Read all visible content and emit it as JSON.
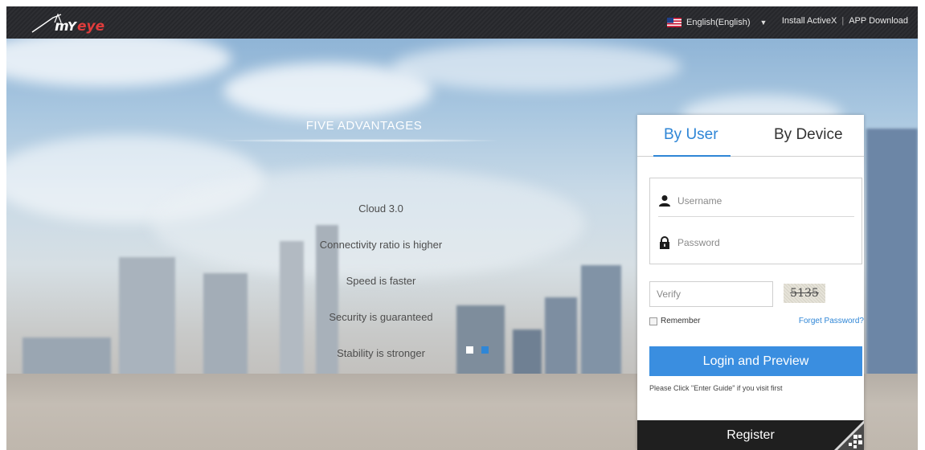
{
  "header": {
    "language_label": "English(English)",
    "install_activex": "Install ActiveX",
    "separator": "|",
    "app_download": "APP Download",
    "flag_icon": "us-flag-icon",
    "caret_icon": "caret-down-icon",
    "caret_glyph": "▼"
  },
  "advantages": {
    "title": "FIVE ADVANTAGES",
    "items": [
      "Cloud 3.0",
      "Connectivity ratio is higher",
      "Speed is faster",
      "Security is guaranteed",
      "Stability is stronger"
    ],
    "carousel_active_index": 1
  },
  "login": {
    "tabs": [
      {
        "label": "By User",
        "active": true
      },
      {
        "label": "By Device",
        "active": false
      }
    ],
    "username_placeholder": "Username",
    "password_placeholder": "Password",
    "verify_placeholder": "Verify",
    "captcha_text": "5135",
    "remember_label": "Remember",
    "forget_password": "Forget Password?",
    "login_button": "Login and Preview",
    "hint": "Please Click \"Enter Guide\" if you visit first",
    "register_button": "Register"
  },
  "colors": {
    "accent": "#2f86d6",
    "button": "#3a8ee0",
    "topbar": "#2a2b2f",
    "register_bg": "#1f1f1f"
  }
}
